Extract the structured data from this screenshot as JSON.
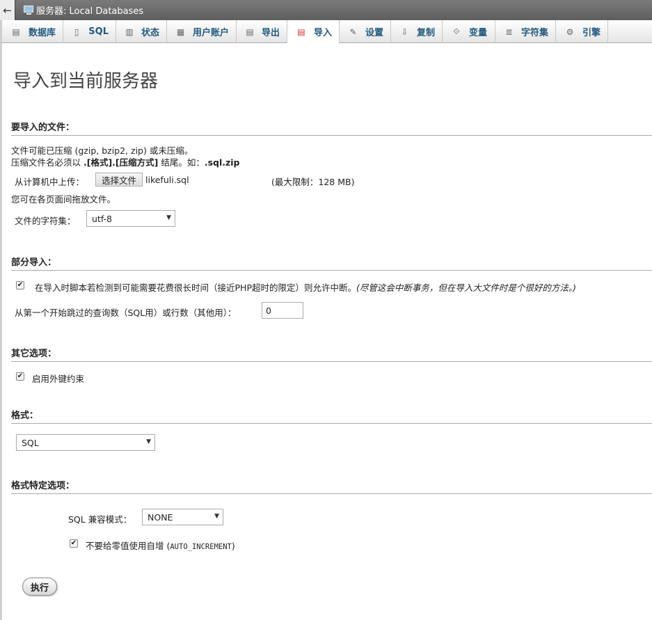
{
  "topbar": {
    "back": "←",
    "server_label": "服务器: Local Databases"
  },
  "tabs": [
    {
      "label": "数据库",
      "icon": "database-icon",
      "glyph": "▤"
    },
    {
      "label": "SQL",
      "icon": "sql-icon",
      "glyph": "▯"
    },
    {
      "label": "状态",
      "icon": "status-icon",
      "glyph": "▥"
    },
    {
      "label": "用户账户",
      "icon": "users-icon",
      "glyph": "▦"
    },
    {
      "label": "导出",
      "icon": "export-icon",
      "glyph": "▤"
    },
    {
      "label": "导入",
      "icon": "import-icon",
      "glyph": "▤"
    },
    {
      "label": "设置",
      "icon": "wrench-icon",
      "glyph": "✎"
    },
    {
      "label": "复制",
      "icon": "replication-icon",
      "glyph": "⇩"
    },
    {
      "label": "变量",
      "icon": "variables-icon",
      "glyph": "⟐"
    },
    {
      "label": "字符集",
      "icon": "charset-icon",
      "glyph": "≣"
    },
    {
      "label": "引擎",
      "icon": "engine-icon",
      "glyph": "⚙"
    }
  ],
  "page": {
    "title": "导入到当前服务器"
  },
  "file_section": {
    "heading": "要导入的文件：",
    "line1": "文件可能已压缩 (gzip, bzip2, zip) 或未压缩。",
    "line2_prefix": "压缩文件名必须以 ",
    "line2_format": ".[格式].[压缩方式]",
    "line2_middle": " 结尾。如：",
    "line2_example": ".sql.zip",
    "upload_label": "从计算机中上传：",
    "choose_button": "选择文件",
    "chosen_file": "likefuli.sql",
    "max_limit": "(最大限制：128 MB)",
    "drag_hint": "您可在各页面间拖放文件。",
    "charset_label": "文件的字符集：",
    "charset_value": "utf-8"
  },
  "partial_section": {
    "heading": "部分导入：",
    "allow_interrupt": "在导入时脚本若检测到可能需要花费很长时间（接近PHP超时的限定）则允许中断。",
    "allow_interrupt_hint": "(尽管这会中断事务，但在导入大文件时是个很好的方法。)",
    "allow_interrupt_checked": true,
    "skip_label": "从第一个开始跳过的查询数（SQL用）或行数（其他用）：",
    "skip_value": "0"
  },
  "other_section": {
    "heading": "其它选项：",
    "foreign_keys": "启用外键约束",
    "foreign_keys_checked": true
  },
  "format_section": {
    "heading": "格式：",
    "format_value": "SQL"
  },
  "format_options": {
    "heading": "格式特定选项：",
    "compat_label": "SQL 兼容模式：",
    "compat_value": "NONE",
    "no_auto_value_label": "不要给零值使用自增 (",
    "no_auto_value_code": "AUTO_INCREMENT",
    "no_auto_value_close": ")",
    "no_auto_value_checked": true
  },
  "go_button": "执行"
}
